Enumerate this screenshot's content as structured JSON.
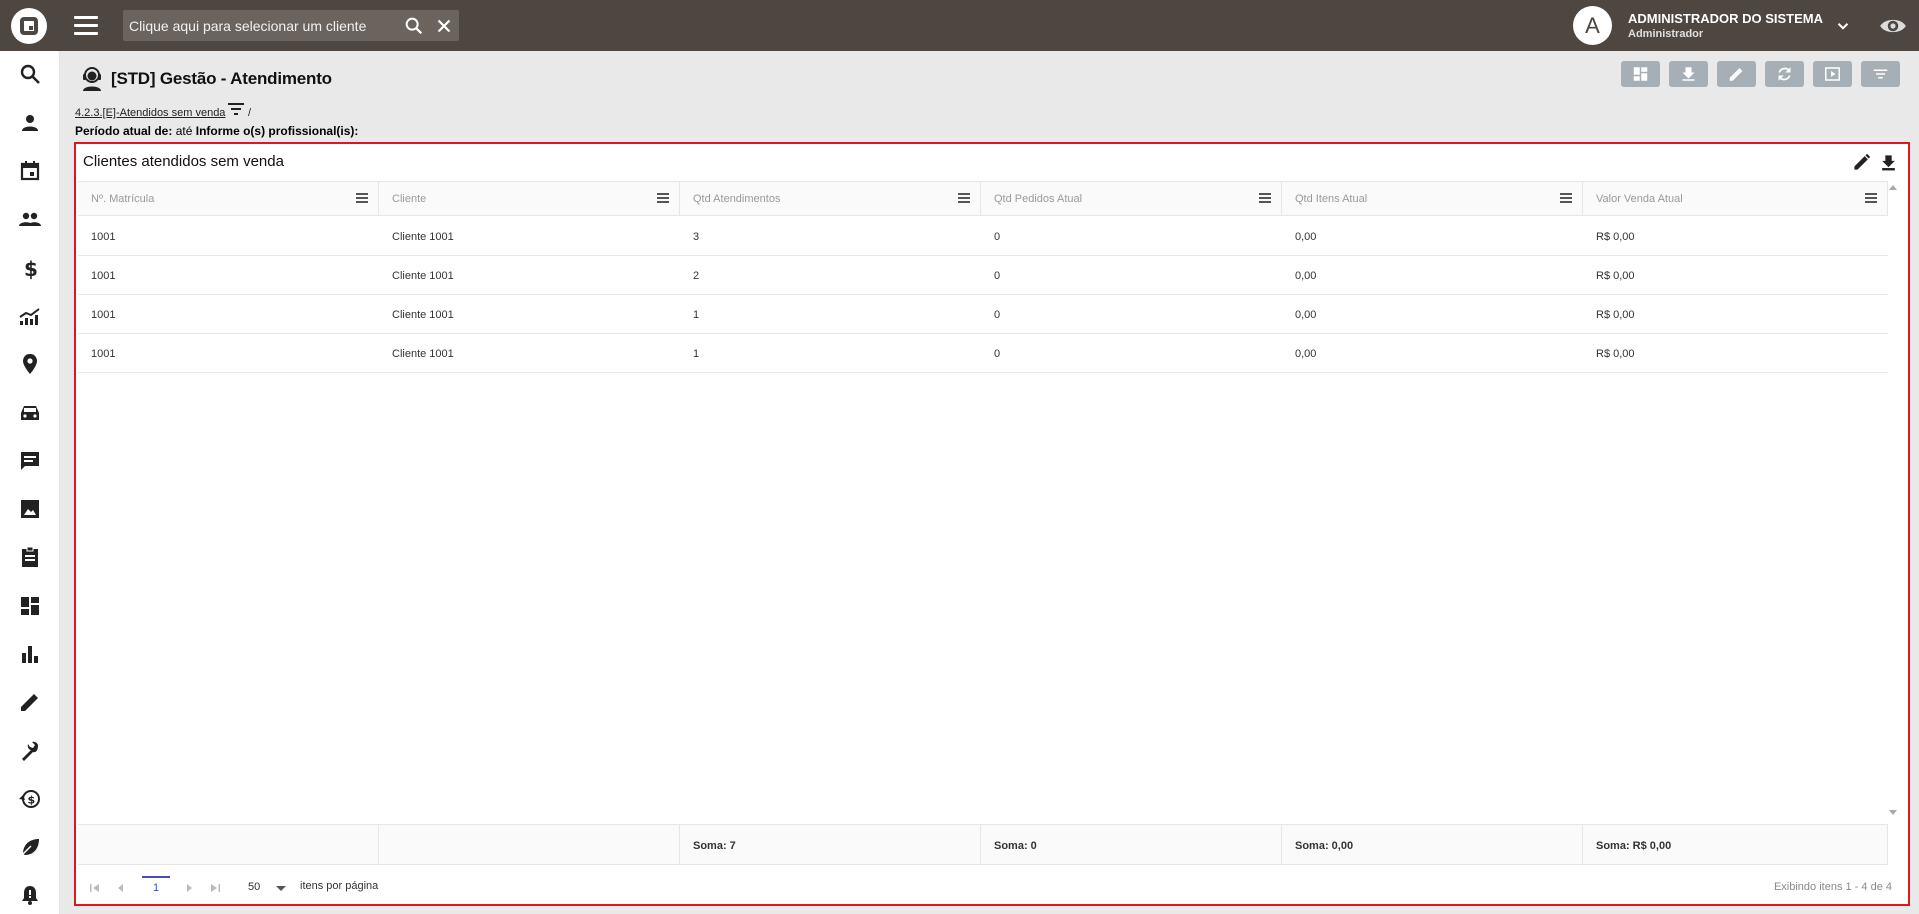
{
  "topbar": {
    "search_placeholder": "Clique aqui para selecionar um cliente",
    "avatar_letter": "A",
    "user_name": "ADMINISTRADOR DO SISTEMA",
    "user_role": "Administrador"
  },
  "sidebar": {
    "icons": [
      "search-icon",
      "person-icon",
      "calendar-icon",
      "group-icon",
      "dollar-icon",
      "trending-icon",
      "location-icon",
      "car-icon",
      "chat-icon",
      "photo-icon",
      "clipboard-icon",
      "dashboard-icon",
      "bar-chart-icon",
      "pencil-icon",
      "wrench-icon",
      "history-dollar-icon",
      "leaf-icon",
      "bell-alert-icon"
    ]
  },
  "page": {
    "title": "[STD] Gestão - Atendimento",
    "toolbar_icons": [
      "layout-icon",
      "download-icon",
      "edit-icon",
      "refresh-icon",
      "play-icon",
      "filter-icon"
    ],
    "breadcrumb_link": "4.2.3.[E]-Atendidos sem venda",
    "breadcrumb_sep": "/",
    "period_label": "Período atual de:",
    "period_text": "até",
    "period_prof": "Informe o(s) profissional(is):"
  },
  "panel": {
    "title": "Clientes atendidos sem venda",
    "columns": [
      "Nº. Matrícula",
      "Cliente",
      "Qtd Atendimentos",
      "Qtd Pedidos Atual",
      "Qtd Itens Atual",
      "Valor Venda Atual"
    ],
    "rows": [
      [
        "1001",
        "Cliente 1001",
        "3",
        "0",
        "0,00",
        "R$ 0,00"
      ],
      [
        "1001",
        "Cliente 1001",
        "2",
        "0",
        "0,00",
        "R$ 0,00"
      ],
      [
        "1001",
        "Cliente 1001",
        "1",
        "0",
        "0,00",
        "R$ 0,00"
      ],
      [
        "1001",
        "Cliente 1001",
        "1",
        "0",
        "0,00",
        "R$ 0,00"
      ]
    ],
    "totals": [
      "",
      "",
      "Soma: 7",
      "Soma: 0",
      "Soma: 0,00",
      "Soma: R$ 0,00"
    ],
    "pager": {
      "current_page": "1",
      "page_size": "50",
      "page_size_label": "itens por página",
      "info": "Exibindo itens 1 - 4 de 4"
    }
  },
  "colors": {
    "topbar": "#4d4641",
    "panel_border": "#e2151b",
    "toolbar_button": "#a6afb6",
    "pager_active": "#3f51b5"
  }
}
